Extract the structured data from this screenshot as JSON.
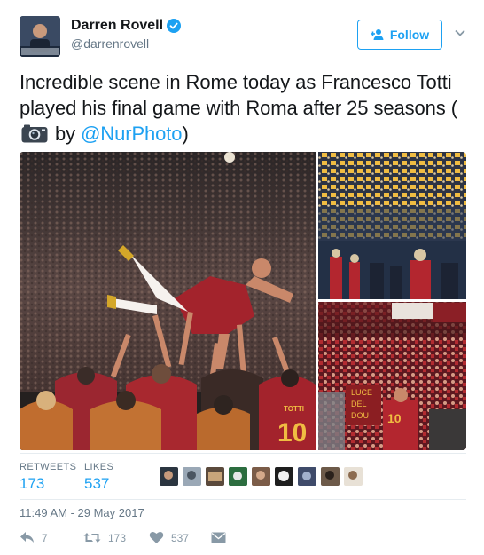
{
  "author": {
    "name": "Darren Rovell",
    "handle": "@darrenrovell",
    "verified": true
  },
  "follow_button": {
    "label": "Follow"
  },
  "tweet": {
    "text_before": "Incredible scene in Rome today as Francesco Totti played his final game with Roma after 25 seasons (",
    "text_by": " by ",
    "mention": "@NurPhoto",
    "text_after": ")",
    "camera_icon": "camera-emoji"
  },
  "media": {
    "jersey_name": "TOTTI",
    "jersey_number": "10",
    "banner_text_1": "LUCE",
    "banner_text_2": "DEL",
    "banner_text_3": "DOU"
  },
  "stats": {
    "retweets_label": "RETWEETS",
    "retweets_value": "173",
    "likes_label": "LIKES",
    "likes_value": "537"
  },
  "timestamp": "11:49 AM - 29 May 2017",
  "actions": {
    "reply_count": "7",
    "retweet_count": "173",
    "like_count": "537"
  },
  "colors": {
    "accent": "#1da1f2",
    "muted": "#657786",
    "roma_red": "#8e1f2f",
    "roma_gold": "#f0bc42"
  }
}
